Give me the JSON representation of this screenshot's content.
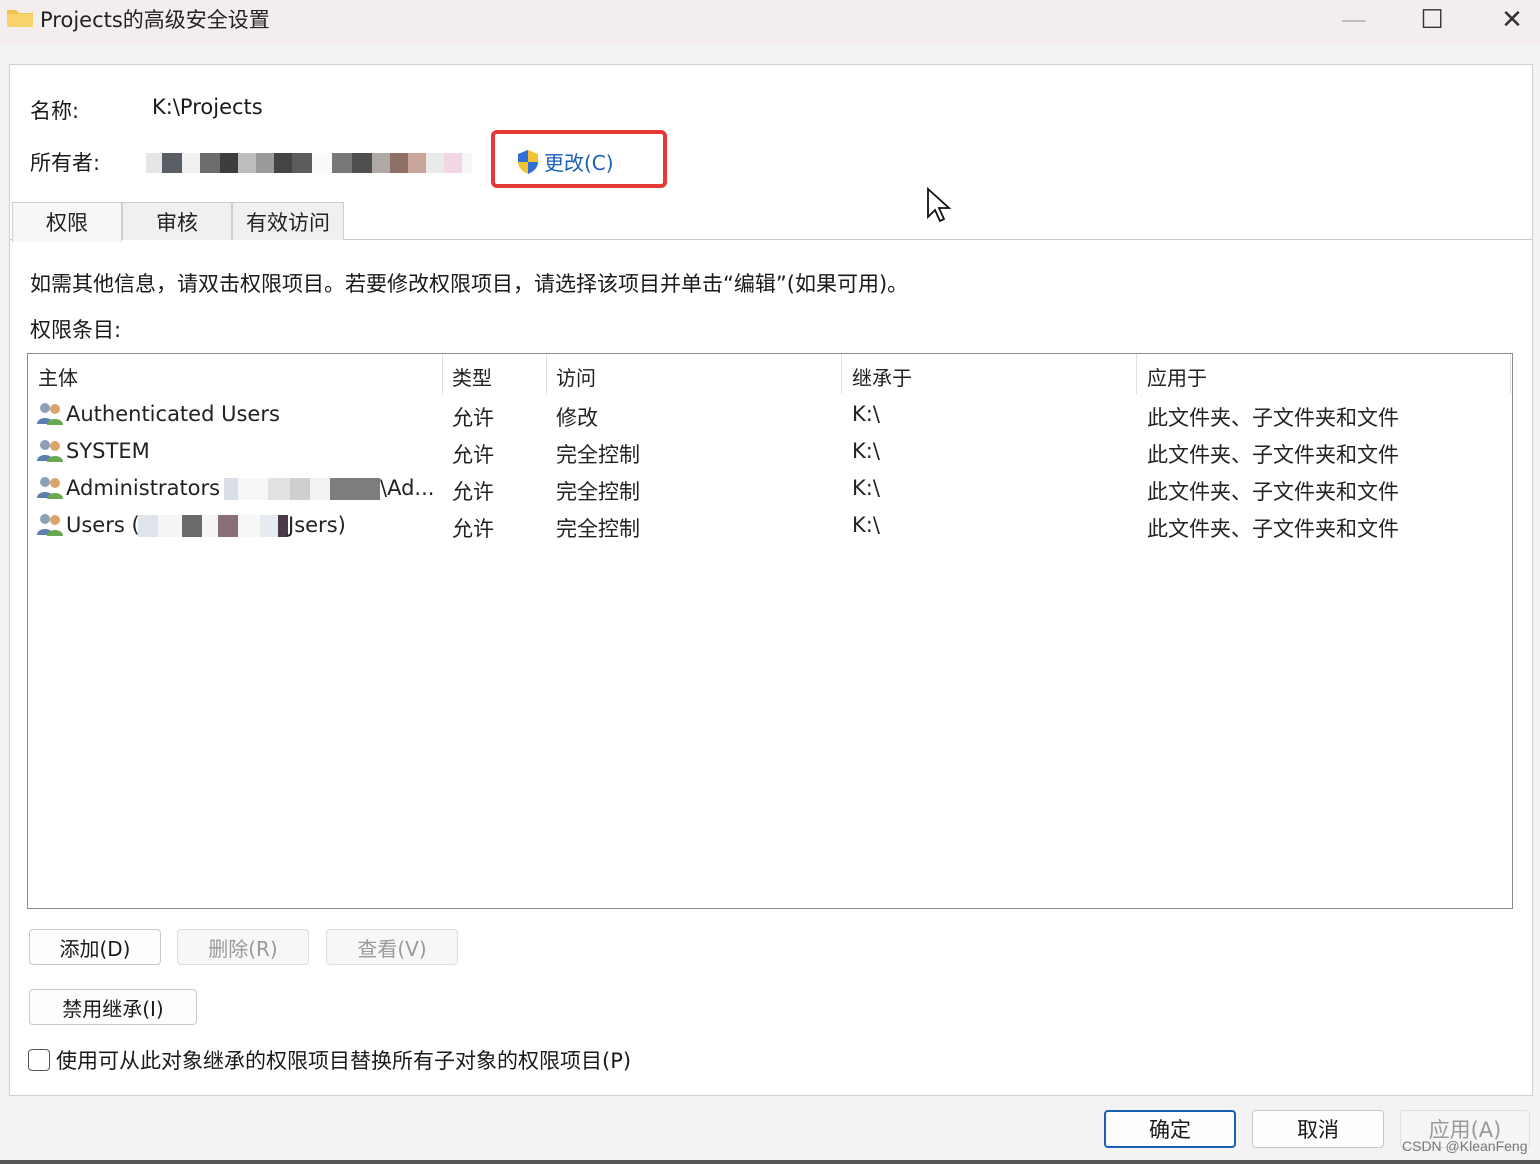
{
  "window": {
    "title": "Projects的高级安全设置",
    "minimize": "—",
    "maximize": "☐",
    "close": "✕"
  },
  "header": {
    "name_label": "名称:",
    "name_value": "K:\\Projects",
    "owner_label": "所有者:",
    "change_label": "更改(C)"
  },
  "tabs": [
    {
      "label": "权限"
    },
    {
      "label": "审核"
    },
    {
      "label": "有效访问"
    }
  ],
  "info_text": "如需其他信息，请双击权限项目。若要修改权限项目，请选择该项目并单击“编辑”(如果可用)。",
  "entries_label": "权限条目:",
  "table": {
    "columns": [
      "主体",
      "类型",
      "访问",
      "继承于",
      "应用于"
    ],
    "rows": [
      {
        "principal": "Authenticated Users",
        "type": "允许",
        "access": "修改",
        "inherited": "K:\\",
        "applies": "此文件夹、子文件夹和文件"
      },
      {
        "principal": "SYSTEM",
        "type": "允许",
        "access": "完全控制",
        "inherited": "K:\\",
        "applies": "此文件夹、子文件夹和文件"
      },
      {
        "principal": "Administrators",
        "principal_suffix": "\\Ad...",
        "type": "允许",
        "access": "完全控制",
        "inherited": "K:\\",
        "applies": "此文件夹、子文件夹和文件"
      },
      {
        "principal": "Users (",
        "principal_suffix": "Jsers)",
        "type": "允许",
        "access": "完全控制",
        "inherited": "K:\\",
        "applies": "此文件夹、子文件夹和文件"
      }
    ]
  },
  "buttons": {
    "add": "添加(D)",
    "remove": "删除(R)",
    "view": "查看(V)",
    "disable_inheritance": "禁用继承(I)",
    "replace_checkbox": "使用可从此对象继承的权限项目替换所有子对象的权限项目(P)",
    "ok": "确定",
    "cancel": "取消",
    "apply": "应用(A)"
  },
  "watermark": "CSDN @KleanFeng",
  "colors": {
    "accent": "#1a5fb4",
    "highlight_box": "#e53935"
  },
  "icons": {
    "title": "folder-icon",
    "change": "uac-shield-icon",
    "principal": "users-icon",
    "cursor": "mouse-cursor-icon"
  }
}
